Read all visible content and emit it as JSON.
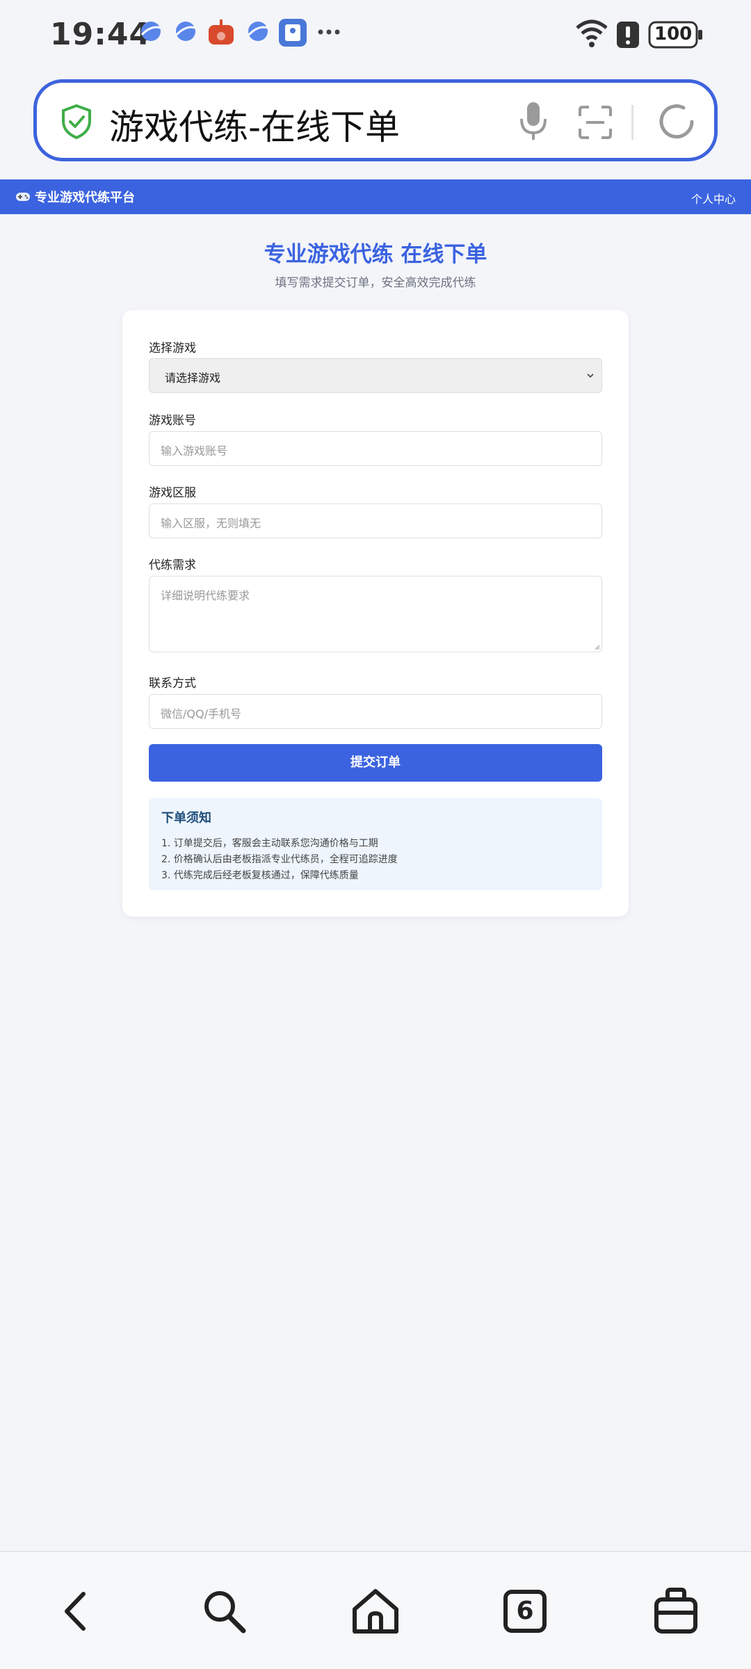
{
  "status_bar": {
    "time": "19:44",
    "battery": "100",
    "icons": [
      "browser-icon",
      "browser-icon",
      "game-icon",
      "browser-icon",
      "app-icon",
      "more-icon",
      "wifi-icon",
      "alert-icon",
      "battery-icon"
    ]
  },
  "url_bar": {
    "title": "游戏代练-在线下单"
  },
  "site_nav": {
    "brand": "专业游戏代练平台",
    "user_center": "个人中心"
  },
  "hero": {
    "title": "专业游戏代练 在线下单",
    "subtitle": "填写需求提交订单，安全高效完成代练"
  },
  "form": {
    "game": {
      "label": "选择游戏",
      "value": "请选择游戏"
    },
    "account": {
      "label": "游戏账号",
      "placeholder": "输入游戏账号"
    },
    "server": {
      "label": "游戏区服",
      "placeholder": "输入区服，无则填无"
    },
    "requirement": {
      "label": "代练需求",
      "placeholder": "详细说明代练要求"
    },
    "contact": {
      "label": "联系方式",
      "placeholder": "微信/QQ/手机号"
    },
    "submit_label": "提交订单"
  },
  "notice": {
    "title": "下单须知",
    "items": [
      "1. 订单提交后，客服会主动联系您沟通价格与工期",
      "2. 价格确认后由老板指派专业代练员，全程可追踪进度",
      "3. 代练完成后经老板复核通过，保障代练质量"
    ]
  },
  "bottom_nav": {
    "tab_count": "6"
  },
  "colors": {
    "accent": "#3b63e0",
    "notice_bg": "#eef5fd",
    "notice_title": "#1e4d7b",
    "page_bg": "#f4f5f9"
  }
}
